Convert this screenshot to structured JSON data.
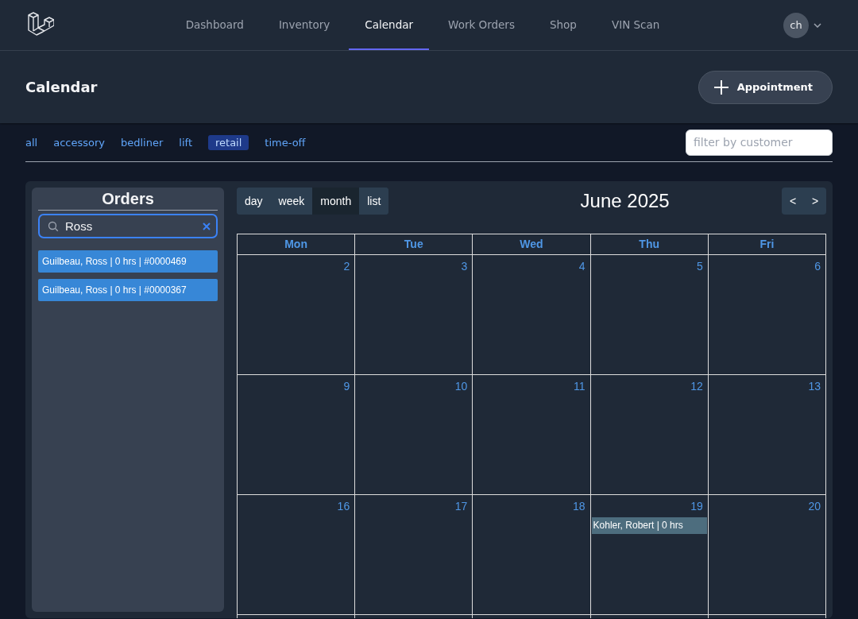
{
  "nav": {
    "links": [
      {
        "label": "Dashboard",
        "selected": false
      },
      {
        "label": "Inventory",
        "selected": false
      },
      {
        "label": "Calendar",
        "selected": true
      },
      {
        "label": "Work Orders",
        "selected": false
      },
      {
        "label": "Shop",
        "selected": false
      },
      {
        "label": "VIN Scan",
        "selected": false
      }
    ],
    "user_initials": "ch"
  },
  "header": {
    "title": "Calendar",
    "button": "Appointment"
  },
  "filters": {
    "tags": [
      {
        "label": "all",
        "selected": false
      },
      {
        "label": "accessory",
        "selected": false
      },
      {
        "label": "bedliner",
        "selected": false
      },
      {
        "label": "lift",
        "selected": false
      },
      {
        "label": "retail",
        "selected": true
      },
      {
        "label": "time-off",
        "selected": false
      }
    ],
    "customer_filter": {
      "placeholder": "filter by customer"
    }
  },
  "orders": {
    "title": "Orders",
    "search": {
      "value": "Ross"
    },
    "items": [
      "Guilbeau, Ross | 0 hrs | #0000469",
      "Guilbeau, Ross | 0 hrs | #0000367"
    ]
  },
  "calendar": {
    "views": [
      {
        "label": "day",
        "selected": false
      },
      {
        "label": "week",
        "selected": false
      },
      {
        "label": "month",
        "selected": true
      },
      {
        "label": "list",
        "selected": false
      }
    ],
    "title": "June 2025",
    "prev": "<",
    "next": ">",
    "weekdays": [
      "Mon",
      "Tue",
      "Wed",
      "Thu",
      "Fri"
    ],
    "weeks": [
      {
        "days": [
          {
            "date": "2"
          },
          {
            "date": "3"
          },
          {
            "date": "4"
          },
          {
            "date": "5"
          },
          {
            "date": "6"
          }
        ]
      },
      {
        "days": [
          {
            "date": "9"
          },
          {
            "date": "10"
          },
          {
            "date": "11"
          },
          {
            "date": "12"
          },
          {
            "date": "13"
          }
        ]
      },
      {
        "days": [
          {
            "date": "16"
          },
          {
            "date": "17"
          },
          {
            "date": "18"
          },
          {
            "date": "19",
            "events": [
              "Kohler, Robert | 0 hrs"
            ]
          },
          {
            "date": "20"
          }
        ]
      }
    ]
  }
}
